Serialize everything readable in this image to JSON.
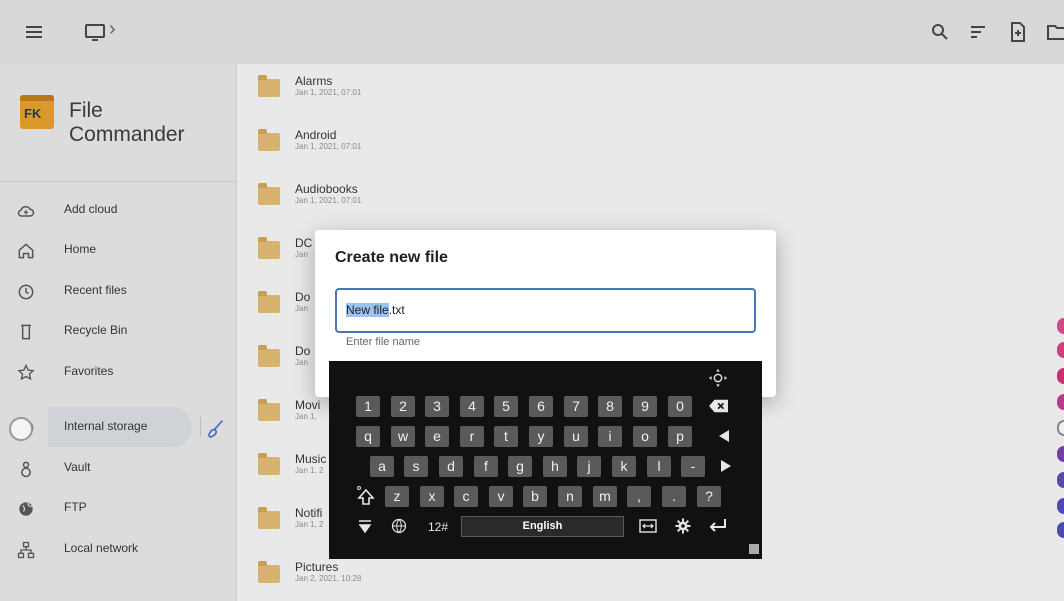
{
  "sidebar": {
    "app_name": "File Commander",
    "logo_text": "FK",
    "items": [
      {
        "label": "Add cloud"
      },
      {
        "label": "Home"
      },
      {
        "label": "Recent files"
      },
      {
        "label": "Recycle Bin"
      },
      {
        "label": "Favorites"
      },
      {
        "label": "Internal storage"
      },
      {
        "label": "Vault"
      },
      {
        "label": "FTP"
      },
      {
        "label": "Local network"
      }
    ]
  },
  "files": [
    {
      "name": "Alarms",
      "date": "Jan 1, 2021, 07:01"
    },
    {
      "name": "Android",
      "date": "Jan 1, 2021, 07:01"
    },
    {
      "name": "Audiobooks",
      "date": "Jan 1, 2021, 07:01"
    },
    {
      "name": "DC",
      "date": "Jan"
    },
    {
      "name": "Do",
      "date": "Jan"
    },
    {
      "name": "Do",
      "date": "Jan"
    },
    {
      "name": "Movi",
      "date": "Jan 1,"
    },
    {
      "name": "Music",
      "date": "Jan 1, 2"
    },
    {
      "name": "Notifi",
      "date": "Jan 1, 2"
    },
    {
      "name": "Pictures",
      "date": "Jan 2, 2021, 10:28"
    }
  ],
  "dialog": {
    "title": "Create new file",
    "value_selected": "New file",
    "value_ext": ".txt",
    "helper": "Enter file name"
  },
  "keyboard": {
    "row1": [
      "1",
      "2",
      "3",
      "4",
      "5",
      "6",
      "7",
      "8",
      "9",
      "0"
    ],
    "row2": [
      "q",
      "w",
      "e",
      "r",
      "t",
      "y",
      "u",
      "i",
      "o",
      "p"
    ],
    "row3": [
      "a",
      "s",
      "d",
      "f",
      "g",
      "h",
      "j",
      "k",
      "l",
      "-"
    ],
    "row4": [
      "z",
      "x",
      "c",
      "v",
      "b",
      "n",
      "m",
      ",",
      ".",
      "?"
    ],
    "numbers_label": "12#",
    "space_label": "English"
  },
  "colors": {
    "accent": "#4a76b8",
    "folder": "#d7b36f",
    "selection": "#9cc2ef"
  }
}
